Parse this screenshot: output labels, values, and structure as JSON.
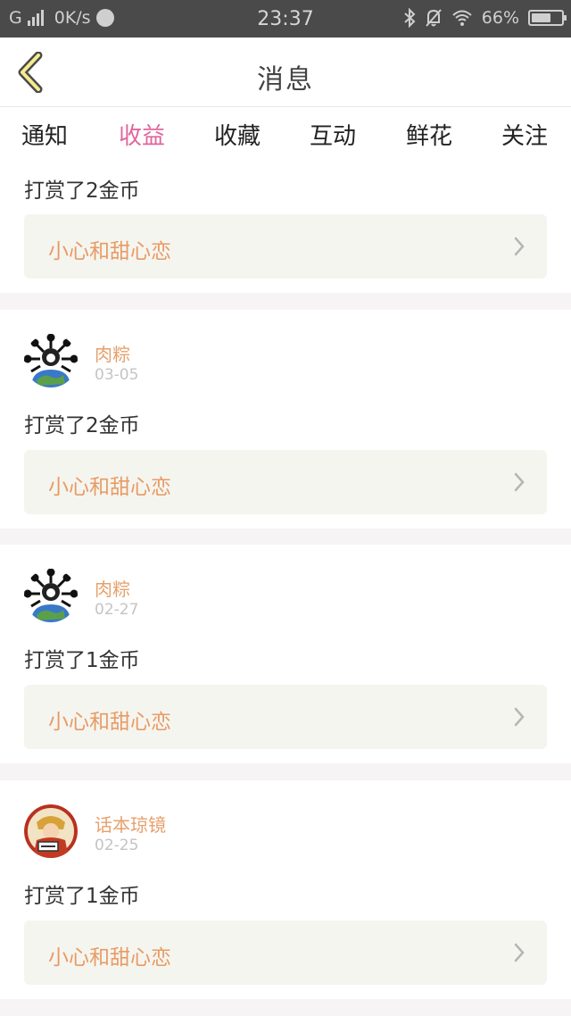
{
  "statusbar": {
    "carrier": "G",
    "speed": "0K/s",
    "time": "23:37",
    "battery": "66%",
    "battery_level": 0.66
  },
  "header": {
    "title": "消息"
  },
  "tabs": [
    {
      "label": "通知"
    },
    {
      "label": "收益",
      "active": true
    },
    {
      "label": "收藏"
    },
    {
      "label": "互动"
    },
    {
      "label": "鲜花"
    },
    {
      "label": "关注"
    }
  ],
  "colors": {
    "accent": "#e0669e",
    "username": "#e6a06c",
    "book_title": "#e89b66",
    "book_bg": "#f5f5ef"
  },
  "messages": [
    {
      "text": "打赏了2金币",
      "book": "小心和甜心恋"
    },
    {
      "user": "肉粽",
      "date": "03-05",
      "text": "打赏了2金币",
      "book": "小心和甜心恋"
    },
    {
      "user": "肉粽",
      "date": "02-27",
      "text": "打赏了1金币",
      "book": "小心和甜心恋"
    },
    {
      "user": "话本琼镜",
      "date": "02-25",
      "text": "打赏了1金币",
      "book": "小心和甜心恋"
    }
  ]
}
